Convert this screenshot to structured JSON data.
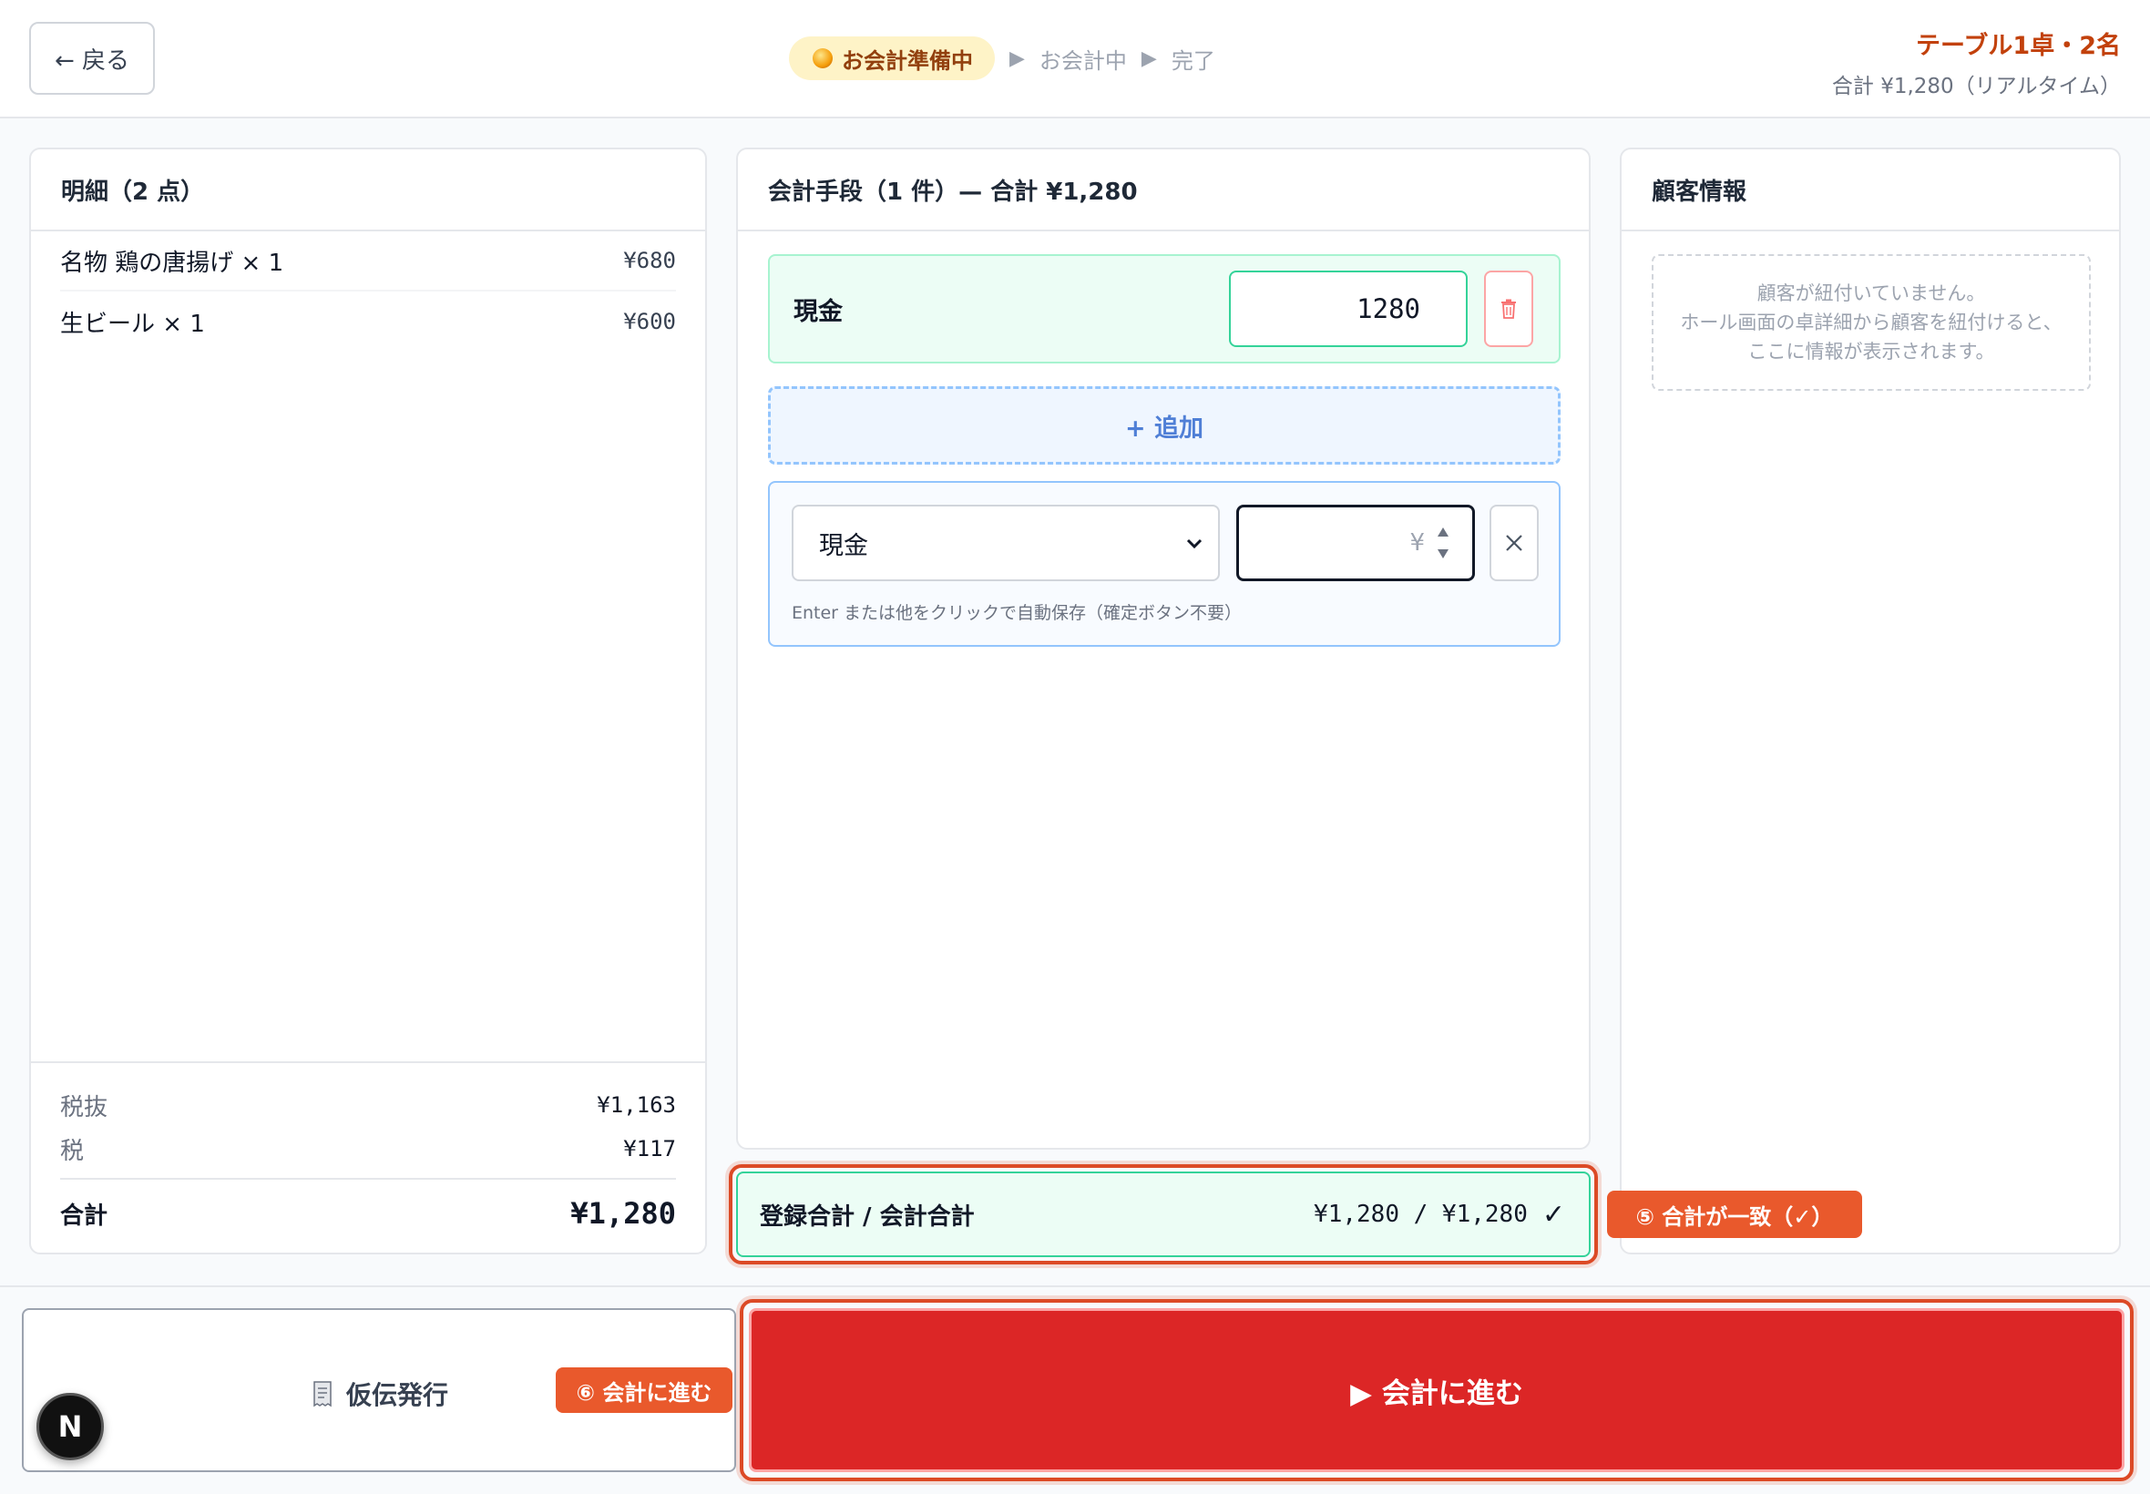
{
  "header": {
    "back_label": "← 戻る",
    "steps": {
      "active": "お会計準備中",
      "step2": "お会計中",
      "step3": "完了"
    },
    "table_name": "テーブル1卓・2名",
    "table_total": "合計 ¥1,280（リアルタイム）"
  },
  "details": {
    "title": "明細（2 点）",
    "items": [
      {
        "name": "名物 鶏の唐揚げ × 1",
        "price": "¥680"
      },
      {
        "name": "生ビール × 1",
        "price": "¥600"
      }
    ],
    "summary": {
      "subtotal_label": "税抜",
      "subtotal": "¥1,163",
      "tax_label": "税",
      "tax": "¥117",
      "total_label": "合計",
      "total": "¥1,280"
    }
  },
  "payment": {
    "title": "会計手段（1 件）— 合計 ¥1,280",
    "registered": {
      "method": "現金",
      "amount": "1280"
    },
    "add_label": "+ 追加",
    "new_entry": {
      "selected_method": "現金",
      "amount_placeholder": "¥",
      "hint": "Enter または他をクリックで自動保存（確定ボタン不要）"
    }
  },
  "customer": {
    "title": "顧客情報",
    "empty_lines": [
      "顧客が紐付いていません。",
      "ホール画面の卓詳細から顧客を紐付けると、",
      "ここに情報が表示されます。"
    ]
  },
  "match": {
    "label": "登録合計 / 会計合計",
    "value": "¥1,280 / ¥1,280",
    "check": "✓"
  },
  "annotations": {
    "badge5": "⑤ 合計が一致（✓）",
    "badge6": "⑥ 会計に進む"
  },
  "footer": {
    "slip_label": "仮伝発行",
    "proceed_label": "▶ 会計に進む"
  },
  "dev_badge": "N",
  "colors": {
    "accent_red": "#dc2626",
    "annotation_orange": "#e9592c",
    "success_green": "#34d399"
  }
}
